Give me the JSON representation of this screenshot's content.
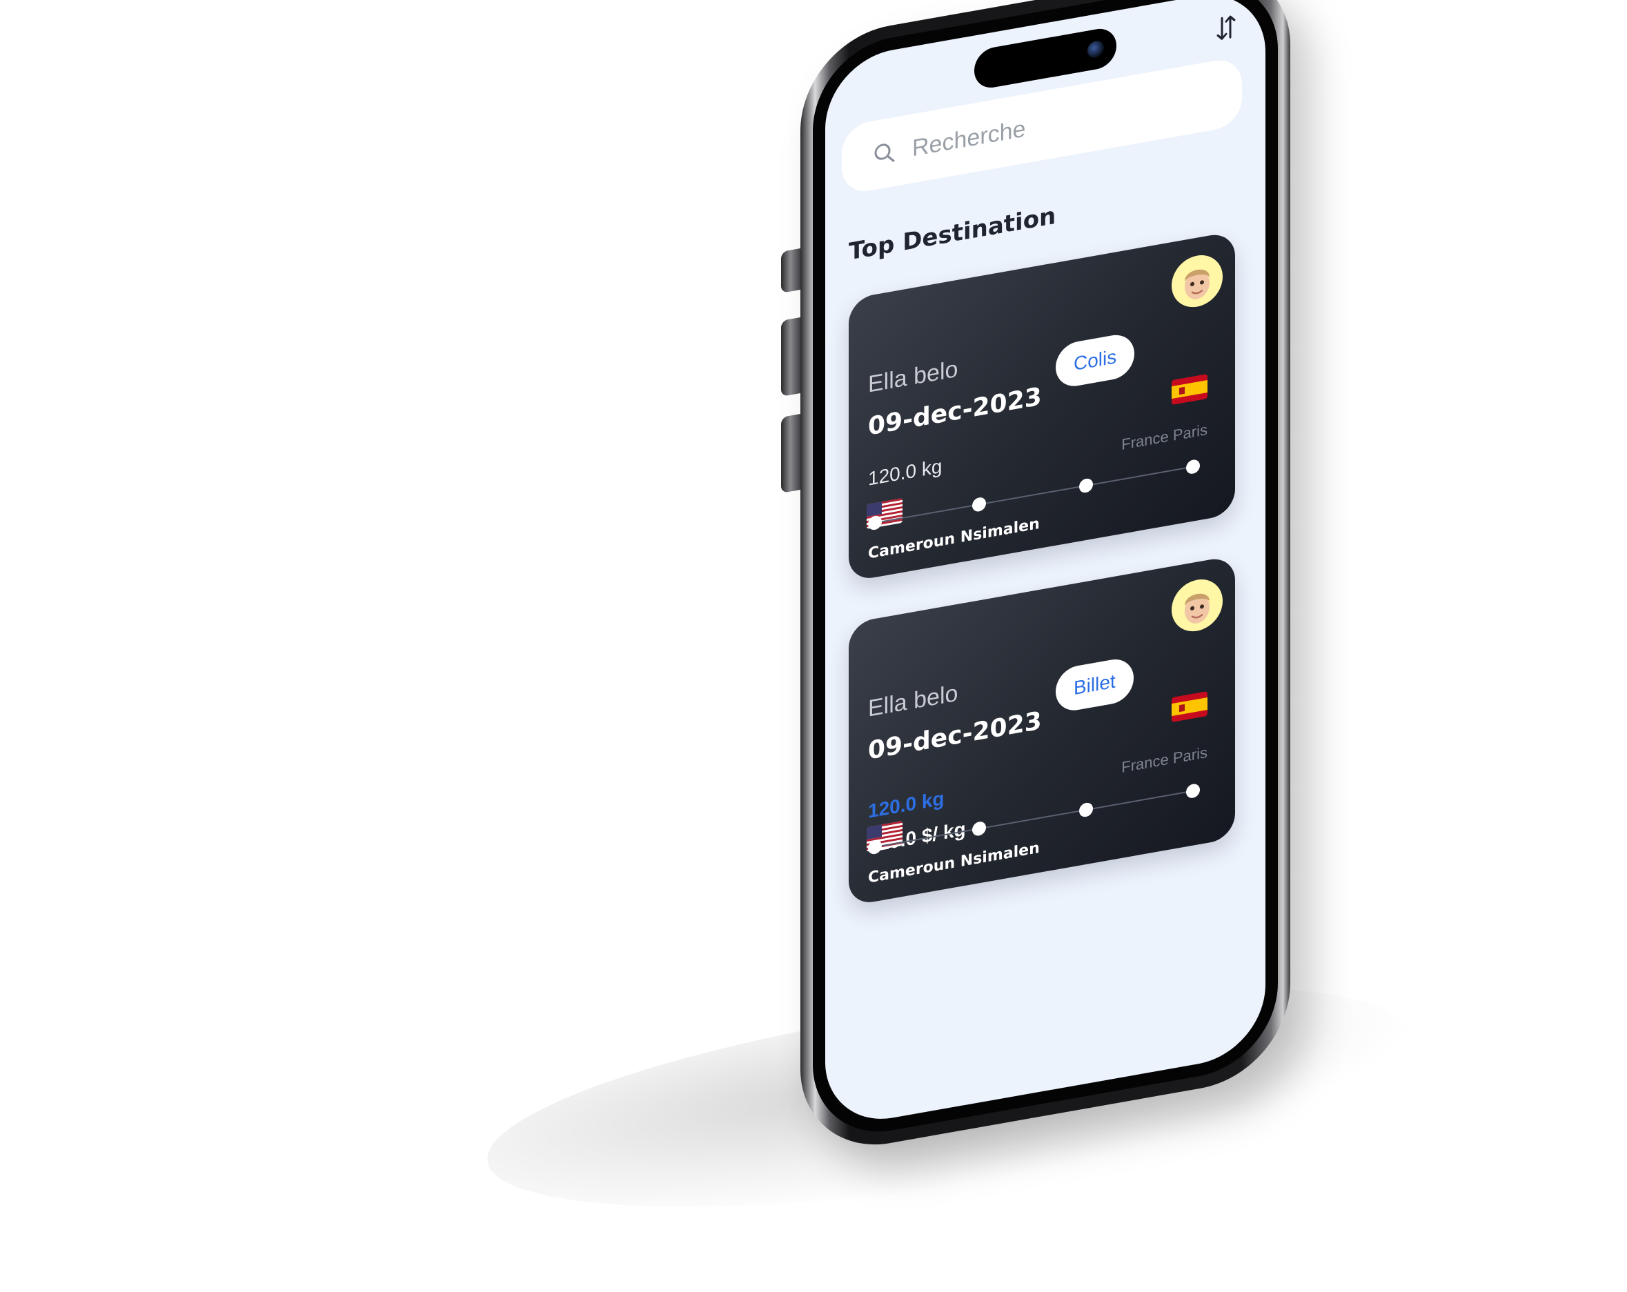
{
  "search": {
    "placeholder": "Recherche"
  },
  "section": {
    "title": "Top Destination"
  },
  "cards": [
    {
      "name": "Ella belo",
      "date": "09-dec-2023",
      "type": "Colis",
      "weight": "120.0  kg",
      "origin": "Cameroun Nsimalen",
      "destination": "France Paris",
      "origin_flag": "us-flag",
      "destination_flag": "es-flag"
    },
    {
      "name": "Ella belo",
      "date": "09-dec-2023",
      "type": "Billet",
      "weight": "120.0  kg",
      "price": "120.0 $/ kg",
      "origin": "Cameroun Nsimalen",
      "destination": "France Paris",
      "origin_flag": "us-flag",
      "destination_flag": "es-flag"
    }
  ],
  "icons": {
    "search": "search-icon",
    "sort": "sort-arrows-icon",
    "avatar": "memoji-avatar"
  },
  "colors": {
    "screen_bg": "#edf3fc",
    "card_bg": "#23272f",
    "accent": "#2d6fe3",
    "avatar_bg": "#fff6a6"
  }
}
